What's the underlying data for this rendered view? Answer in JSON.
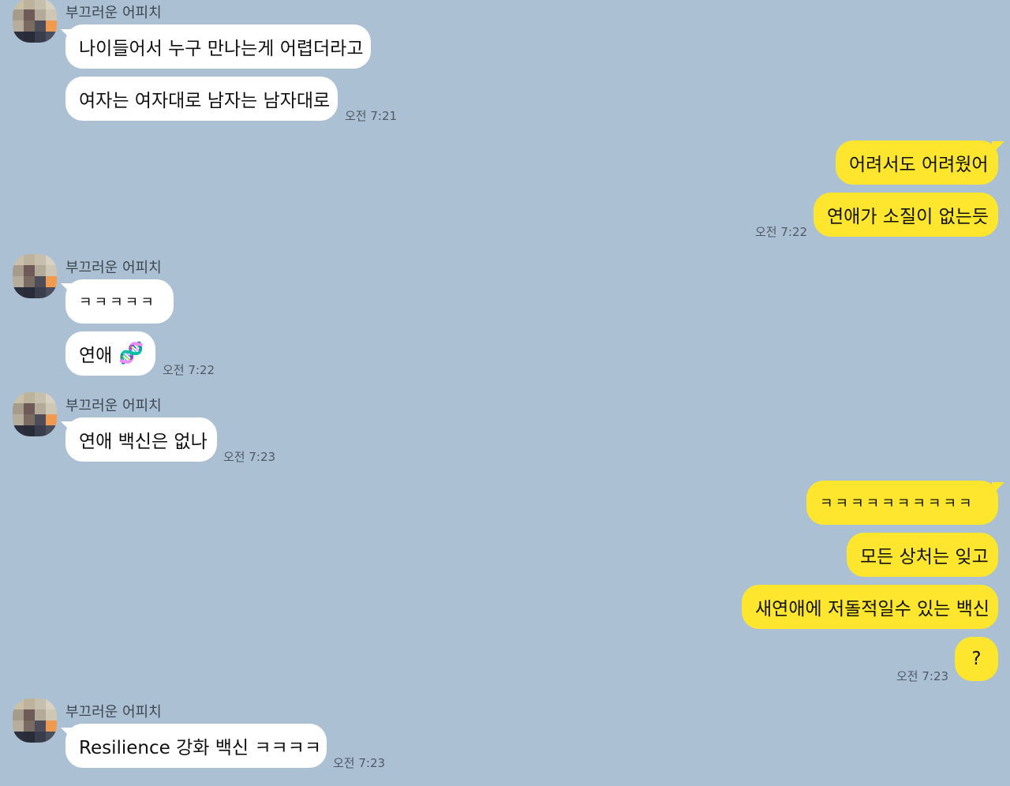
{
  "sender_name": "부끄러운 어피치",
  "colors": {
    "background": "#abc0d3",
    "incoming": "#ffffff",
    "outgoing": "#fde62d"
  },
  "messages": [
    {
      "text": "나이들어서 누구 만나는게 어렵더라고"
    },
    {
      "text": "여자는 여자대로 남자는 남자대로",
      "time": "오전 7:21"
    },
    {
      "text": "어려서도 어려웠어"
    },
    {
      "text": "연애가 소질이 없는듯",
      "time": "오전 7:22"
    },
    {
      "text": "ㅋㅋㅋㅋㅋ"
    },
    {
      "text": "연애",
      "emoji": "🧬",
      "emoji_name": "dna-emoji",
      "time": "오전 7:22"
    },
    {
      "text": "연애 백신은 없나",
      "time": "오전 7:23"
    },
    {
      "text": "ㅋㅋㅋㅋㅋㅋㅋㅋㅋㅋ"
    },
    {
      "text": "모든 상처는 잊고"
    },
    {
      "text": "새연애에 저돌적일수 있는 백신"
    },
    {
      "text": "?",
      "time": "오전 7:23"
    },
    {
      "text": "Resilience 강화 백신 ㅋㅋㅋㅋ",
      "time": "오전 7:23"
    }
  ]
}
